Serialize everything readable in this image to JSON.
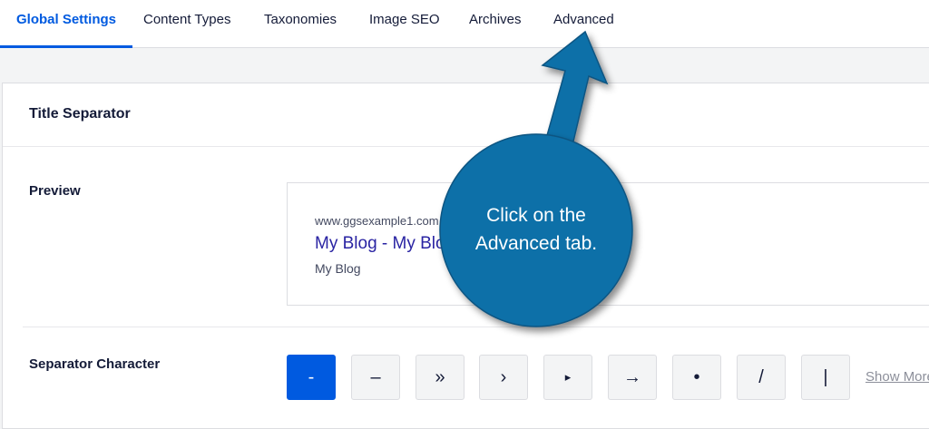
{
  "tabs": {
    "global": "Global Settings",
    "content_types": "Content Types",
    "taxonomies": "Taxonomies",
    "image_seo": "Image SEO",
    "archives": "Archives",
    "advanced": "Advanced"
  },
  "card": {
    "title": "Title Separator",
    "preview_label": "Preview",
    "preview": {
      "url": "www.ggsexample1.com",
      "title": "My Blog - My Blog",
      "description": "My Blog"
    },
    "separator_label": "Separator Character",
    "separators": [
      "-",
      "–",
      "»",
      "›",
      "▸",
      "→",
      "•",
      "/",
      "|"
    ],
    "show_more": "Show More"
  },
  "callout": {
    "line1": "Click on the",
    "line2": "Advanced tab."
  },
  "colors": {
    "accent": "#005ae0",
    "callout": "#0d6fa8"
  }
}
